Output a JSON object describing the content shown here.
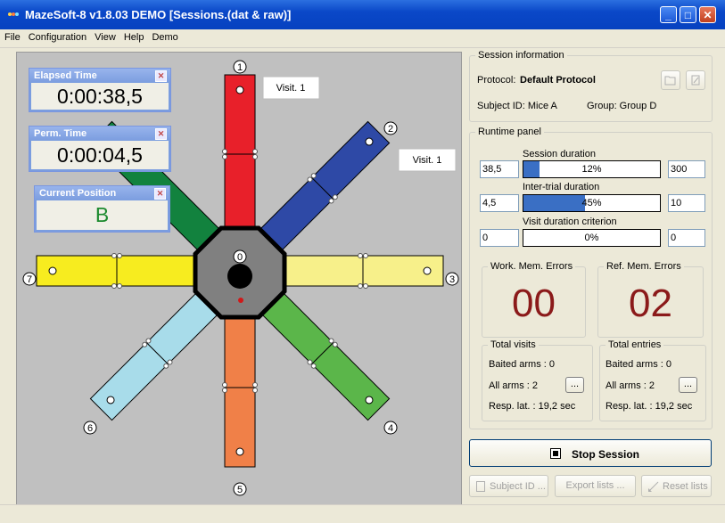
{
  "window": {
    "title": "MazeSoft-8 v1.8.03 DEMO [Sessions.(dat & raw)]"
  },
  "menu": [
    "File",
    "Configuration",
    "View",
    "Help",
    "Demo"
  ],
  "elapsed": {
    "title": "Elapsed Time",
    "value": "0:00:38,5"
  },
  "perm": {
    "title": "Perm. Time",
    "value": "0:00:04,5"
  },
  "position": {
    "title": "Current Position",
    "value": "B"
  },
  "maze": {
    "arm_labels": [
      "1",
      "2",
      "3",
      "4",
      "5",
      "6",
      "7"
    ],
    "center_label": "0",
    "visit_labels": [
      "Visit. 1",
      "Visit. 1"
    ],
    "arm_colors": [
      "#e8202a",
      "#2e49a6",
      "#f7f08a",
      "#5bb64a",
      "#f08048",
      "#a8dcea",
      "#f7ec1f",
      "#12823e"
    ]
  },
  "session": {
    "legend": "Session information",
    "protocol_label": "Protocol:",
    "protocol_value": "Default Protocol",
    "subject": "Subject ID: Mice A",
    "group": "Group: Group D"
  },
  "runtime": {
    "legend": "Runtime panel",
    "session_duration": {
      "label": "Session duration",
      "left": "38,5",
      "right": "300",
      "pct": "12%",
      "fraction": 0.12
    },
    "intertrial": {
      "label": "Inter-trial duration",
      "left": "4,5",
      "right": "10",
      "pct": "45%",
      "fraction": 0.45
    },
    "visit_criterion": {
      "label": "Visit duration criterion",
      "left": "0",
      "right": "0",
      "pct": "0%",
      "fraction": 0
    }
  },
  "errors": {
    "work_label": "Work. Mem. Errors",
    "work_value": "00",
    "ref_label": "Ref. Mem. Errors",
    "ref_value": "02"
  },
  "visits": {
    "legend": "Total visits",
    "baited": "Baited arms : 0",
    "all": "All arms :  2",
    "resp": "Resp. lat. : 19,2 sec",
    "button": "..."
  },
  "entries": {
    "legend": "Total entries",
    "baited": "Baited arms : 0",
    "all": "All arms :  2",
    "resp": "Resp. lat. : 19,2 sec",
    "button": "..."
  },
  "buttons": {
    "stop": "Stop Session",
    "subject": "Subject ID ...",
    "export": "Export lists ...",
    "reset": "Reset lists"
  }
}
